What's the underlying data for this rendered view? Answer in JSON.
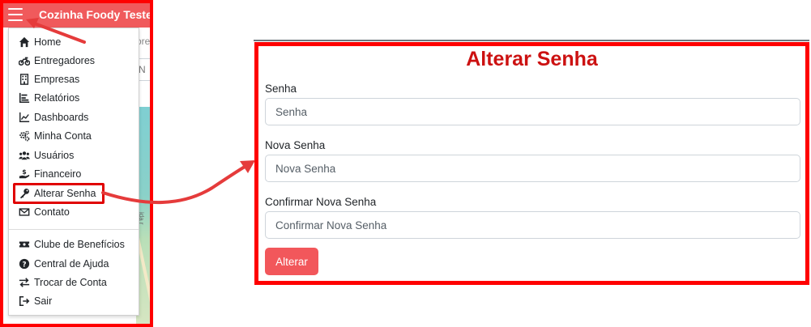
{
  "app": {
    "title": "Cozinha Foody Teste"
  },
  "background": {
    "peek_text": "ore",
    "peek_input": "N",
    "map_label": "ida r"
  },
  "menu": {
    "items": [
      {
        "label": "Home",
        "icon": "home-icon"
      },
      {
        "label": "Entregadores",
        "icon": "motorcycle-icon"
      },
      {
        "label": "Empresas",
        "icon": "building-icon"
      },
      {
        "label": "Relatórios",
        "icon": "list-chart-icon"
      },
      {
        "label": "Dashboards",
        "icon": "line-chart-icon"
      },
      {
        "label": "Minha Conta",
        "icon": "gears-icon"
      },
      {
        "label": "Usuários",
        "icon": "users-icon"
      },
      {
        "label": "Financeiro",
        "icon": "hand-dollar-icon"
      },
      {
        "label": "Alterar Senha",
        "icon": "key-icon"
      },
      {
        "label": "Contato",
        "icon": "envelope-icon"
      },
      {
        "label": "Clube de Benefícios",
        "icon": "ticket-icon"
      },
      {
        "label": "Central de Ajuda",
        "icon": "question-circle-icon"
      },
      {
        "label": "Trocar de Conta",
        "icon": "exchange-icon"
      },
      {
        "label": "Sair",
        "icon": "sign-out-icon"
      }
    ]
  },
  "form": {
    "title": "Alterar Senha",
    "fields": [
      {
        "label": "Senha",
        "placeholder": "Senha"
      },
      {
        "label": "Nova Senha",
        "placeholder": "Nova Senha"
      },
      {
        "label": "Confirmar Nova Senha",
        "placeholder": "Confirmar Nova Senha"
      }
    ],
    "submit_label": "Alterar"
  },
  "colors": {
    "header": "#f05a5c",
    "highlight_border": "#ff0000",
    "title_red": "#cc1111",
    "button": "#f2575b",
    "arrow": "#e53b3b"
  }
}
